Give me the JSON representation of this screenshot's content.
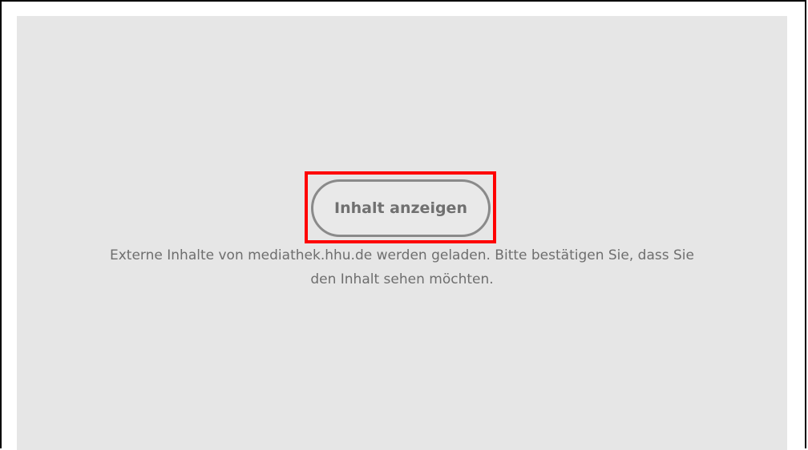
{
  "embed": {
    "button_label": "Inhalt anzeigen",
    "notice_line1": "Externe Inhalte von mediathek.hhu.de werden geladen. Bitte bestätigen Sie, dass Sie",
    "notice_line2": "den Inhalt sehen möchten."
  },
  "colors": {
    "placeholder_background": "#e6e6e6",
    "button_border": "#8a8a8a",
    "text": "#6e6e6e",
    "highlight": "#ff0000"
  }
}
